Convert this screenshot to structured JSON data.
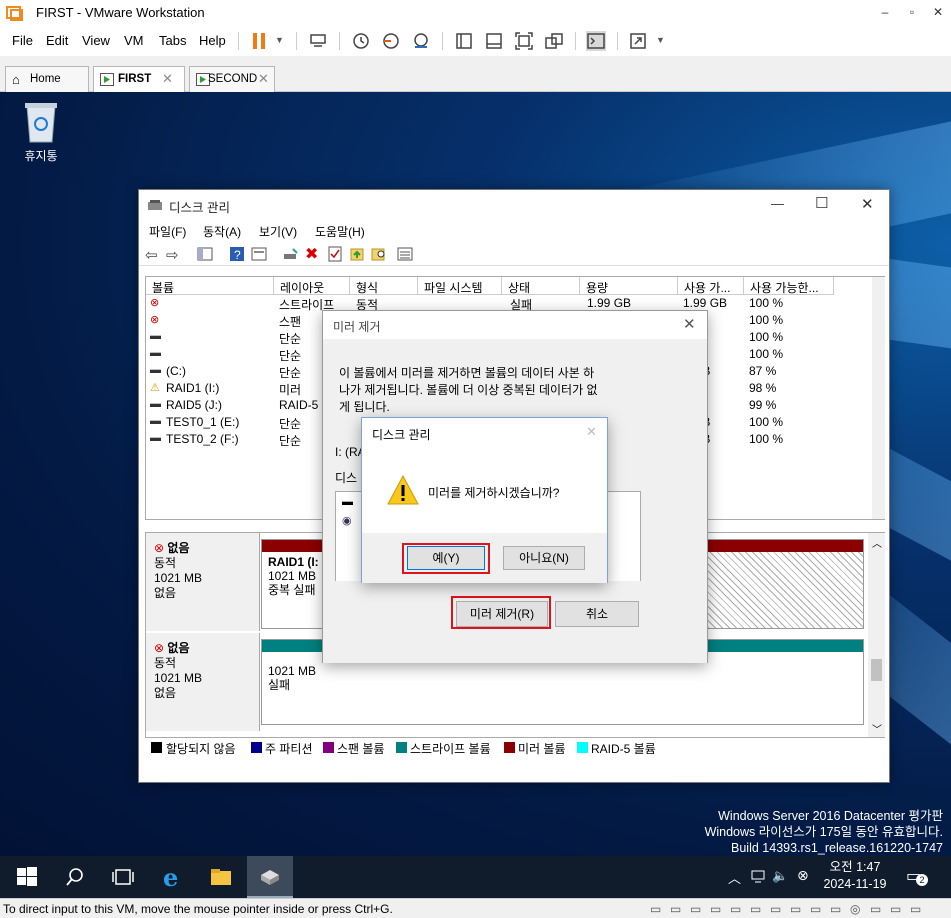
{
  "window": {
    "title": "FIRST - VMware Workstation"
  },
  "menubar": {
    "items": [
      "File",
      "Edit",
      "View",
      "VM",
      "Tabs",
      "Help"
    ]
  },
  "tabs": [
    {
      "label": "Home",
      "active": false
    },
    {
      "label": "FIRST",
      "active": true
    },
    {
      "label": "SECOND",
      "active": false
    }
  ],
  "desktop": {
    "recycle_bin": "휴지통"
  },
  "disk_mgmt": {
    "title": "디스크 관리",
    "menu": [
      "파일(F)",
      "동작(A)",
      "보기(V)",
      "도움말(H)"
    ],
    "columns": [
      "볼륨",
      "레이아웃",
      "형식",
      "파일 시스템",
      "상태",
      "용량",
      "사용 가...",
      "사용 가능한..."
    ],
    "rows": [
      {
        "volume": "",
        "layout": "스트라이프",
        "type": "동적",
        "status": "실패",
        "capacity": "1.99 GB",
        "free": "1.99 GB",
        "pct": "100 %",
        "icon": "error-disk-icon"
      },
      {
        "volume": "",
        "layout": "스팬",
        "type": "",
        "status": "",
        "capacity": "",
        "free": "GB",
        "pct": "100 %",
        "icon": "error-disk-icon"
      },
      {
        "volume": "",
        "layout": "단순",
        "type": "",
        "status": "",
        "capacity": "",
        "free": "MB",
        "pct": "100 %",
        "icon": "disk-icon"
      },
      {
        "volume": "",
        "layout": "단순",
        "type": "",
        "status": "",
        "capacity": "",
        "free": "MB",
        "pct": "100 %",
        "icon": "disk-icon"
      },
      {
        "volume": "(C:)",
        "layout": "단순",
        "type": "",
        "status": "",
        "capacity": "",
        "free": "7 GB",
        "pct": "87 %",
        "icon": "disk-icon"
      },
      {
        "volume": "RAID1 (I:)",
        "layout": "미러",
        "type": "",
        "status": "",
        "capacity": "",
        "free": "MB",
        "pct": "98 %",
        "icon": "warning-disk-icon"
      },
      {
        "volume": "RAID5 (J:)",
        "layout": "RAID-5",
        "type": "",
        "status": "",
        "capacity": "",
        "free": "GB",
        "pct": "99 %",
        "icon": "disk-icon"
      },
      {
        "volume": "TEST0_1 (E:)",
        "layout": "단순",
        "type": "",
        "status": "",
        "capacity": "",
        "free": "9 GB",
        "pct": "100 %",
        "icon": "disk-icon"
      },
      {
        "volume": "TEST0_2 (F:)",
        "layout": "단순",
        "type": "",
        "status": "",
        "capacity": "",
        "free": "9 GB",
        "pct": "100 %",
        "icon": "disk-icon"
      }
    ],
    "disk_a": {
      "name": "없음",
      "type": "동적",
      "size": "1021 MB",
      "state": "없음",
      "part_name": "RAID1 (I:",
      "part_size": "1021 MB",
      "part_status": "중복 실패"
    },
    "disk_b": {
      "name": "없음",
      "type": "동적",
      "size": "1021 MB",
      "state": "없음",
      "part_size": "1021 MB",
      "part_status": "실패"
    },
    "legend": [
      {
        "label": "할당되지 않음",
        "color": "#000000"
      },
      {
        "label": "주 파티션",
        "color": "#00008b"
      },
      {
        "label": "스팬 볼륨",
        "color": "#800080"
      },
      {
        "label": "스트라이프 볼륨",
        "color": "#008080"
      },
      {
        "label": "미러 볼륨",
        "color": "#8b0000"
      },
      {
        "label": "RAID-5 볼륨",
        "color": "#00ffff"
      }
    ]
  },
  "remove_mirror_dialog": {
    "title": "미러 제거",
    "text_line1": "이 볼륨에서 미러를 제거하면 볼륨의 데이터 사본 하",
    "text_line2": "나가 제거됩니다. 볼륨에 더 이상 중복된 데이터가 없",
    "text_line3": "게 됩니다.",
    "volume_label": "I: (RA",
    "disk_label": "디스",
    "ok": "미러 제거(R)",
    "cancel": "취소"
  },
  "confirm_dialog": {
    "title": "디스크 관리",
    "message": "미러를 제거하시겠습니까?",
    "yes": "예(Y)",
    "no": "아니요(N)"
  },
  "watermark": {
    "line1": "Windows Server 2016 Datacenter 평가판",
    "line2": "Windows 라이선스가 175일 동안 유효합니다.",
    "line3": "Build 14393.rs1_release.161220-1747"
  },
  "clock": {
    "time": "오전 1:47",
    "date": "2024-11-19",
    "notifications": "2"
  },
  "statusbar": {
    "text": "To direct input to this VM, move the mouse pointer inside or press Ctrl+G."
  }
}
